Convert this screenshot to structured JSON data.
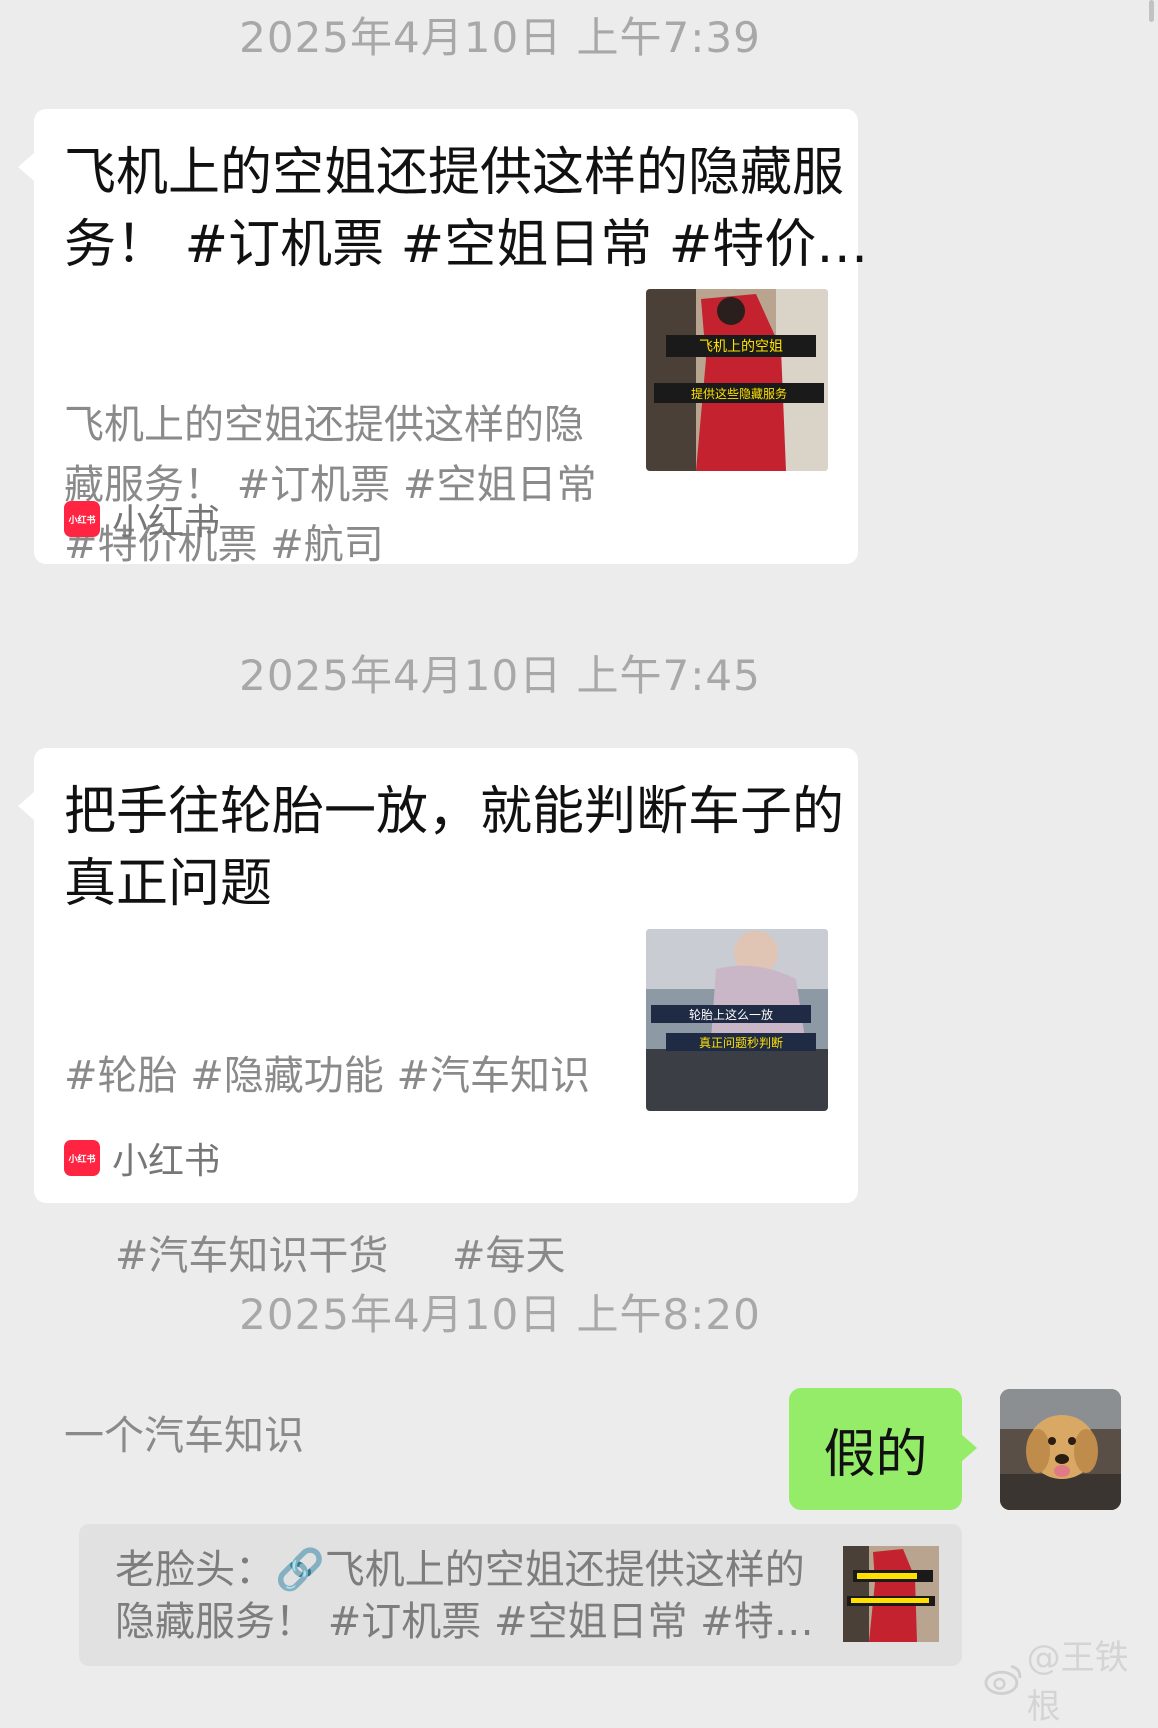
{
  "messages": [
    {
      "timestamp": "2025年4月10日 上午7:39",
      "title_lines": [
        "飞机上的空姐还提供这样的隐藏服",
        "务！ #订机票 #空姐日常 #特价…"
      ],
      "desc_lines": [
        "飞机上的空姐还提供这样的隐",
        "藏服务！ #订机票 #空姐日常",
        "#特价机票 #航司"
      ],
      "source": "小红书",
      "thumb_caption_top": "飞机上的空姐",
      "thumb_caption_bottom": "提供这些隐藏服务"
    },
    {
      "timestamp": "2025年4月10日 上午7:45",
      "title_lines": [
        "把手往轮胎一放，就能判断车子的",
        "真正问题"
      ],
      "desc_lines": [
        "#轮胎 #隐藏功能 #汽车知识",
        "    #汽车知识干货     #每天",
        "一个汽车知识"
      ],
      "source": "小红书",
      "thumb_caption_top": "轮胎上这么一放",
      "thumb_caption_bottom": "真正问题秒判断"
    }
  ],
  "reply": {
    "timestamp": "2025年4月10日 上午8:20",
    "text": "假的",
    "quote_lines": [
      "老脸头：🔗飞机上的空姐还提供这样的",
      "隐藏服务！ #订机票 #空姐日常 #特…"
    ]
  },
  "source_logo_text": "小红书",
  "watermark": "@王铁根",
  "colors": {
    "background": "#ececec",
    "card": "#ffffff",
    "self_bubble": "#95ec69",
    "quote_bg": "#e1e1e1",
    "brand_red": "#ff2442"
  }
}
